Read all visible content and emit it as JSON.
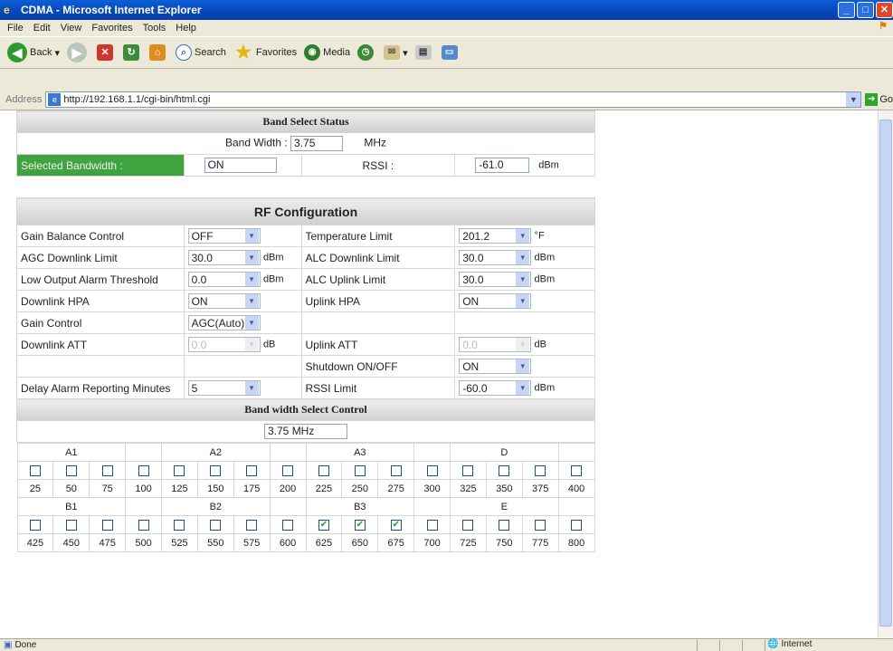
{
  "window": {
    "title": "CDMA - Microsoft Internet Explorer"
  },
  "menu": [
    "File",
    "Edit",
    "View",
    "Favorites",
    "Tools",
    "Help"
  ],
  "toolbar": {
    "back": "Back",
    "search": "Search",
    "favorites": "Favorites",
    "media": "Media"
  },
  "address": {
    "label": "Address",
    "url": "http://192.168.1.1/cgi-bin/html.cgi",
    "go": "Go"
  },
  "status": {
    "done": "Done",
    "zone": "Internet"
  },
  "band_status": {
    "title": "Band Select Status",
    "bw_label": "Band Width :",
    "bw_value": "3.75",
    "bw_unit": "MHz",
    "selected_label": "Selected Bandwidth :",
    "selected_value": "ON",
    "rssi_label": "RSSI :",
    "rssi_value": "-61.0",
    "rssi_unit": "dBm"
  },
  "rf": {
    "title": "RF Configuration",
    "gain_balance_label": "Gain Balance Control",
    "gain_balance": "OFF",
    "temp_label": "Temperature Limit",
    "temp": "201.2",
    "temp_unit": "°F",
    "agc_dl_label": "AGC Downlink Limit",
    "agc_dl": "30.0",
    "agc_dl_unit": "dBm",
    "alc_dl_label": "ALC Downlink Limit",
    "alc_dl": "30.0",
    "alc_dl_unit": "dBm",
    "low_out_label": "Low Output Alarm Threshold",
    "low_out": "0.0",
    "low_out_unit": "dBm",
    "alc_ul_label": "ALC Uplink Limit",
    "alc_ul": "30.0",
    "alc_ul_unit": "dBm",
    "dl_hpa_label": "Downlink HPA",
    "dl_hpa": "ON",
    "ul_hpa_label": "Uplink HPA",
    "ul_hpa": "ON",
    "gain_ctrl_label": "Gain Control",
    "gain_ctrl": "AGC(Auto)",
    "dl_att_label": "Downlink ATT",
    "dl_att": "0.0",
    "dl_att_unit": "dB",
    "ul_att_label": "Uplink ATT",
    "ul_att": "0.0",
    "ul_att_unit": "dB",
    "shutdown_label": "Shutdown ON/OFF",
    "shutdown": "ON",
    "delay_label": "Delay Alarm Reporting Minutes",
    "delay": "5",
    "rssi_limit_label": "RSSI Limit",
    "rssi_limit": "-60.0",
    "rssi_limit_unit": "dBm"
  },
  "bw_control": {
    "title": "Band width Select Control",
    "value": "3.75 MHz",
    "group_row1": [
      "A1",
      "A2",
      "A3",
      "D"
    ],
    "values_row1": [
      "25",
      "50",
      "75",
      "100",
      "125",
      "150",
      "175",
      "200",
      "225",
      "250",
      "275",
      "300",
      "325",
      "350",
      "375",
      "400"
    ],
    "checked_row1": [
      false,
      false,
      false,
      false,
      false,
      false,
      false,
      false,
      false,
      false,
      false,
      false,
      false,
      false,
      false,
      false
    ],
    "group_row2": [
      "B1",
      "B2",
      "B3",
      "E"
    ],
    "values_row2": [
      "425",
      "450",
      "475",
      "500",
      "525",
      "550",
      "575",
      "600",
      "625",
      "650",
      "675",
      "700",
      "725",
      "750",
      "775",
      "800"
    ],
    "checked_row2": [
      false,
      false,
      false,
      false,
      false,
      false,
      false,
      false,
      true,
      true,
      true,
      false,
      false,
      false,
      false,
      false
    ]
  }
}
